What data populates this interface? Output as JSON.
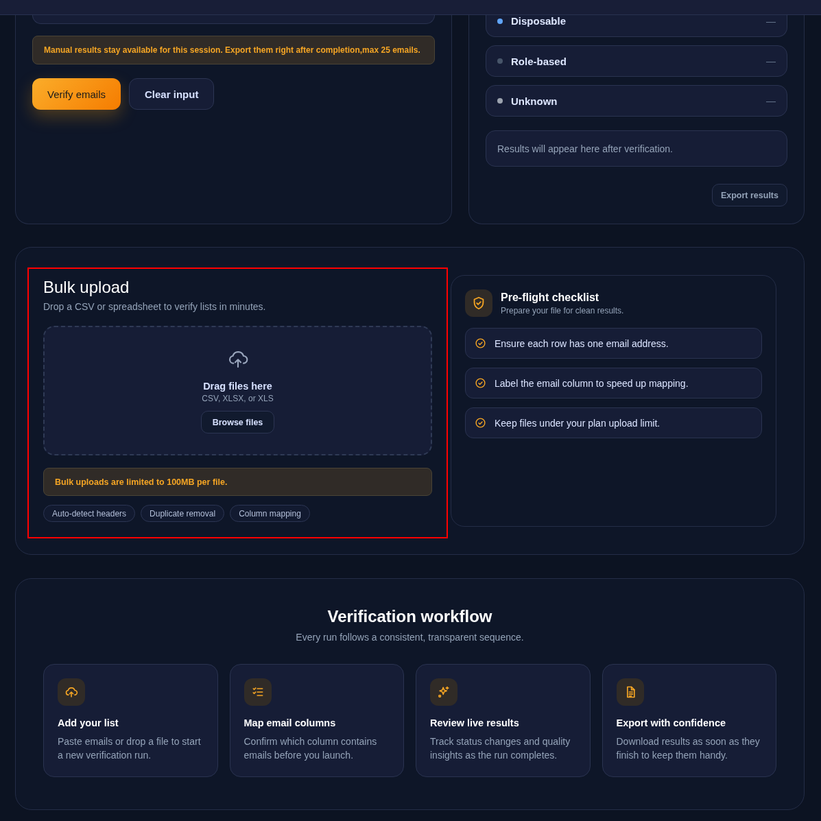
{
  "manual_panel": {
    "notice": "Manual results stay available for this session. Export them right after completion,max 25 emails.",
    "buttons": [
      {
        "label": "Verify emails",
        "kind": "primary"
      },
      {
        "label": "Clear input",
        "kind": "secondary"
      }
    ]
  },
  "results_panel": {
    "categories": [
      {
        "name": "Disposable",
        "color": "#60a5fa",
        "value": "—"
      },
      {
        "name": "Role-based",
        "color": "#475569",
        "value": "—"
      },
      {
        "name": "Unknown",
        "color": "#9ca3af",
        "value": "—"
      }
    ],
    "empty_message": "Results will appear here after verification.",
    "export_button": "Export results"
  },
  "bulk_upload": {
    "highlighted": true,
    "title": "Bulk upload",
    "subtitle": "Drop a CSV or spreadsheet to verify lists in minutes.",
    "dropzone": {
      "title": "Drag files here",
      "formats": "CSV, XLSX, or XLS",
      "button": "Browse files"
    },
    "notice": "Bulk uploads are limited to 100MB per file.",
    "features": [
      "Auto-detect headers",
      "Duplicate removal",
      "Column mapping"
    ]
  },
  "checklist": {
    "title": "Pre-flight checklist",
    "subtitle": "Prepare your file for clean results.",
    "items": [
      "Ensure each row has one email address.",
      "Label the email column to speed up mapping.",
      "Keep files under your plan upload limit."
    ]
  },
  "workflow": {
    "title": "Verification workflow",
    "subtitle": "Every run follows a consistent, transparent sequence.",
    "steps": [
      {
        "kind": "upload",
        "title": "Add your list",
        "text": "Paste emails or drop a file to start a new verification run."
      },
      {
        "kind": "map",
        "title": "Map email columns",
        "text": "Confirm which column contains emails before you launch."
      },
      {
        "kind": "review",
        "title": "Review live results",
        "text": "Track status changes and quality insights as the run completes."
      },
      {
        "kind": "export",
        "title": "Export with confidence",
        "text": "Download results as soon as they finish to keep them handy."
      }
    ]
  }
}
